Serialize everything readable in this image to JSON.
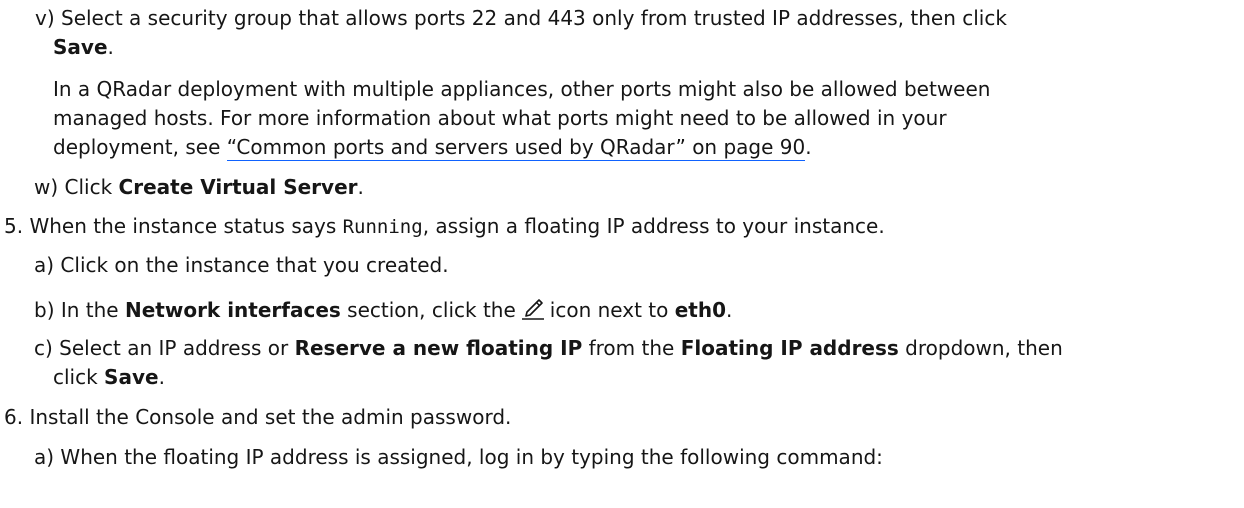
{
  "step_v": {
    "label": "v)",
    "text1": "Select a security group that allows ports 22 and 443 only from trusted IP addresses, then click",
    "save": "Save",
    "end": ".",
    "note1": "In a QRadar deployment with multiple appliances, other ports might also be allowed between",
    "note2": "managed hosts. For more information about what ports might need to be allowed in your",
    "note3_pre": "deployment, see ",
    "note3_link": "“Common ports and servers used by QRadar” on page 90",
    "note3_end": "."
  },
  "step_w": {
    "label": "w)",
    "pre": "Click ",
    "bold": "Create Virtual Server",
    "end": "."
  },
  "step_5": {
    "label": "5.",
    "pre": "When the instance status says ",
    "code": "Running",
    "post": ", assign a floating IP address to your instance.",
    "a": {
      "label": "a)",
      "text": "Click on the instance that you created."
    },
    "b": {
      "label": "b)",
      "pre": "In the ",
      "bold1": "Network interfaces",
      "mid": " section, click the",
      "icon": "pencil-edit-icon",
      "post": "icon next to ",
      "bold2": "eth0",
      "end": "."
    },
    "c": {
      "label": "c)",
      "pre": "Select an IP address or ",
      "bold1": "Reserve a new floating IP",
      "mid": " from the ",
      "bold2": "Floating IP address",
      "post": " dropdown, then",
      "line2_pre": "click ",
      "bold3": "Save",
      "end": "."
    }
  },
  "step_6": {
    "label": "6.",
    "text": "Install the Console and set the admin password.",
    "a": {
      "label": "a)",
      "text": "When the floating IP address is assigned, log in by typing the following command:"
    }
  },
  "colors": {
    "text": "#161616",
    "link_underline": "#0f62fe"
  }
}
